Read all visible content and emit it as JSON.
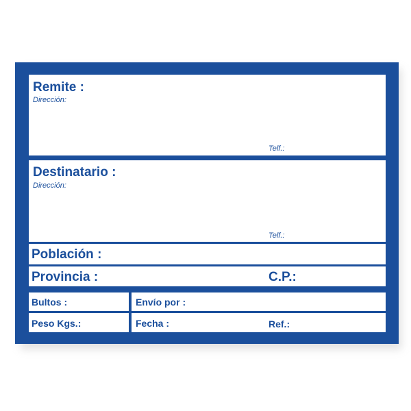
{
  "colors": {
    "brand_blue": "#1b4f9c",
    "field_background": "#ffffff"
  },
  "sender": {
    "title": "Remite :",
    "address_label": "Dirección:",
    "phone_label": "Telf.:"
  },
  "recipient": {
    "title": "Destinatario :",
    "address_label": "Dirección:",
    "phone_label": "Telf.:"
  },
  "location": {
    "town_label": "Población :",
    "province_label": "Provincia :",
    "postal_code_label": "C.P.:"
  },
  "shipment": {
    "packages_label": "Bultos :",
    "sent_via_label": "Envío por :",
    "weight_label": "Peso Kgs.:",
    "date_label": "Fecha :",
    "reference_label": "Ref.:"
  }
}
